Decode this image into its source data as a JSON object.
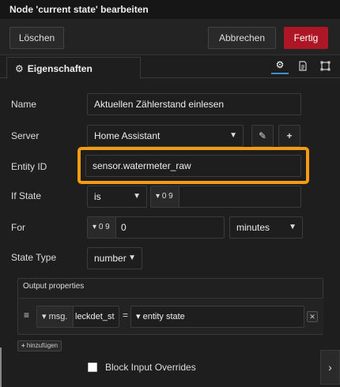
{
  "title": "Node 'current state' bearbeiten",
  "buttons": {
    "delete": "Löschen",
    "cancel": "Abbrechen",
    "done": "Fertig"
  },
  "tab": {
    "label": "Eigenschaften"
  },
  "tab_icons": [
    "gear-icon",
    "description-icon",
    "appearance-icon"
  ],
  "fields": {
    "name": {
      "label": "Name",
      "value": "Aktuellen Zählerstand einlesen"
    },
    "server": {
      "label": "Server",
      "value": "Home Assistant"
    },
    "entity_id": {
      "label": "Entity ID",
      "value": "sensor.watermeter_raw"
    },
    "if_state": {
      "label": "If State",
      "operator": "is",
      "type_glyph": "0 9",
      "value": ""
    },
    "for": {
      "label": "For",
      "type_glyph": "0 9",
      "value": "0",
      "unit": "minutes"
    },
    "state_type": {
      "label": "State Type",
      "value": "number"
    }
  },
  "output": {
    "title": "Output properties",
    "prefix": "msg.",
    "property": "leckdet_st",
    "equals": "=",
    "value": "entity state",
    "add_label": "hinzufügen"
  },
  "block_input": {
    "label": "Block Input Overrides",
    "checked": false
  },
  "colors": {
    "accent": "#ad1625",
    "highlight": "#f39c12",
    "tab_active": "#3e8ed0"
  }
}
